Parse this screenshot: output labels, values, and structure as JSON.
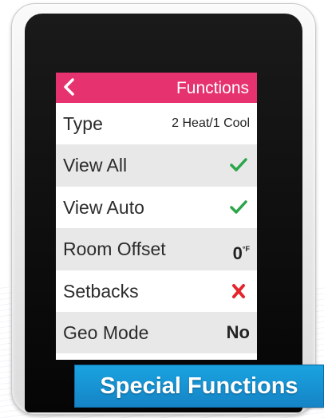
{
  "screen": {
    "header": {
      "title": "Functions",
      "back_icon": "chevron-left-icon"
    },
    "rows": [
      {
        "label": "Type",
        "value": "2 Heat/1 Cool"
      },
      {
        "label": "View All",
        "icon": "check-icon"
      },
      {
        "label": "View Auto",
        "icon": "check-icon"
      },
      {
        "label": "Room Offset",
        "value": "0",
        "unit": "°F"
      },
      {
        "label": "Setbacks",
        "icon": "cross-icon"
      },
      {
        "label": "Geo Mode",
        "value": "No"
      }
    ]
  },
  "banner": {
    "text": "Special Functions"
  },
  "colors": {
    "header": "#e6336f",
    "check": "#2aa54a",
    "cross": "#e4262c",
    "banner": "#1a97d8"
  }
}
